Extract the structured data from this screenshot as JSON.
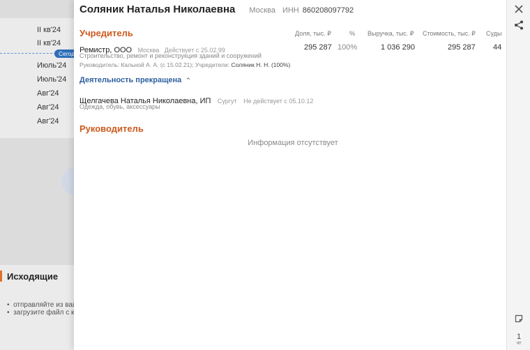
{
  "background": {
    "periods": [
      "II кв'24",
      "II кв'24",
      "Июль'24",
      "Июль'24",
      "Авг'24",
      "Авг'24",
      "Авг'24"
    ],
    "today_badge": "Сегод",
    "outgoing_title": "Исходящие",
    "outgoing_items": [
      "отправляйте из ваш",
      "загрузите файл с к"
    ]
  },
  "header": {
    "name": "Соляник Наталья Николаевна",
    "city": "Москва",
    "inn_label": "ИНН",
    "inn_value": "860208097792"
  },
  "founder": {
    "title": "Учредитель",
    "columns": [
      "Доля, тыс. ₽",
      "%",
      "Выручка, тыс. ₽",
      "Стоимость, тыс. ₽",
      "Суды"
    ],
    "company": {
      "name": "Ремистр, ООО",
      "city": "Москва",
      "status": "Действует с 25.02.99",
      "activity": "Строительство, ремонт и реконструкция зданий и сооружений",
      "management_label": "Руководитель: Кальной А. А. (с 15.02.21); Учредители:",
      "founders_value": "Соляник Н. Н. (100%)",
      "share": "295 287",
      "percent": "100%",
      "revenue": "1 036 290",
      "cost": "295 287",
      "courts": "44"
    },
    "stopped_label": "Деятельность прекращена",
    "stopped_items": [
      {
        "name": "Щелгачева Наталья Николаевна, ИП",
        "city": "Сургут",
        "status": "Не действует с 05.10.12",
        "activity": "Одежда, обувь, аксессуары"
      }
    ]
  },
  "manager": {
    "title": "Руководитель",
    "empty_text": "Информация отсутствует"
  },
  "rail": {
    "page_number": "1",
    "page_sub": "чт"
  }
}
